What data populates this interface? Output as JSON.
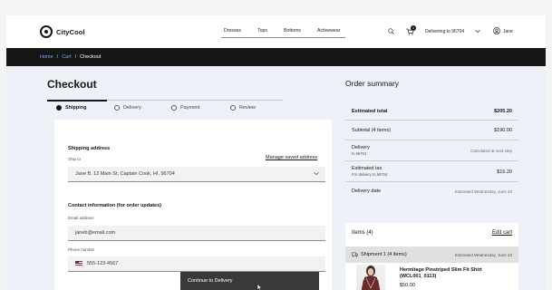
{
  "header": {
    "logo_text": "CityCool",
    "nav": [
      "Dresses",
      "Tops",
      "Bottoms",
      "Activewear"
    ],
    "cart_count": "1",
    "delivery_text": "Delivering to 96704",
    "user_name": "Jane"
  },
  "breadcrumb": {
    "home": "Home",
    "cart": "Cart",
    "current": "Checkout",
    "separator": "/"
  },
  "checkout": {
    "title": "Checkout",
    "steps": [
      {
        "label": "Shipping",
        "active": true
      },
      {
        "label": "Delivery",
        "active": false
      },
      {
        "label": "Payment",
        "active": false
      },
      {
        "label": "Review",
        "active": false
      }
    ],
    "shipping": {
      "title": "Shipping address",
      "ship_to_label": "Ship to",
      "manage_link": "Manage saved address",
      "address_value": "Jane B. 12 Main St, Captain Cook, HI, 96704"
    },
    "contact": {
      "title": "Contact information (for order updates)",
      "email_label": "Email address",
      "email_value": "janeb@email.com",
      "phone_label": "Phone number",
      "phone_value": "555-123-4567"
    },
    "continue_label": "Continue to Delivery"
  },
  "summary": {
    "title": "Order summary",
    "estimated_total_label": "Estimated total",
    "estimated_total_value": "$205.20",
    "subtotal_label": "Subtotal (4 items)",
    "subtotal_value": "$190.00",
    "delivery_label": "Delivery",
    "delivery_sub": "to 96704",
    "delivery_value": "Calculated at next step",
    "tax_label": "Estimated tax",
    "tax_sub": "For delivery to 96704",
    "tax_value": "$15.20",
    "delivery_date_label": "Delivery date",
    "delivery_date_value": "Estimated Wednesday, June 23"
  },
  "items": {
    "title": "Items (4)",
    "edit_label": "Edit cart",
    "shipment_label": "Shipment 1 (4 items)",
    "shipment_date": "Estimated Wednesday, June 23",
    "product_name": "Hermitage Pinstriped Slim Fit Shirt (WCL001_0113)",
    "product_price": "$50.00"
  },
  "colors": {
    "dark_bar": "#161616",
    "link_blue": "#78a9ff",
    "page_bg": "#eef1f7",
    "button": "#393939"
  },
  "icons": [
    "logo-icon",
    "search-icon",
    "cart-icon",
    "chevron-down-icon",
    "user-icon",
    "truck-icon",
    "flag-us-icon",
    "cursor-icon"
  ]
}
